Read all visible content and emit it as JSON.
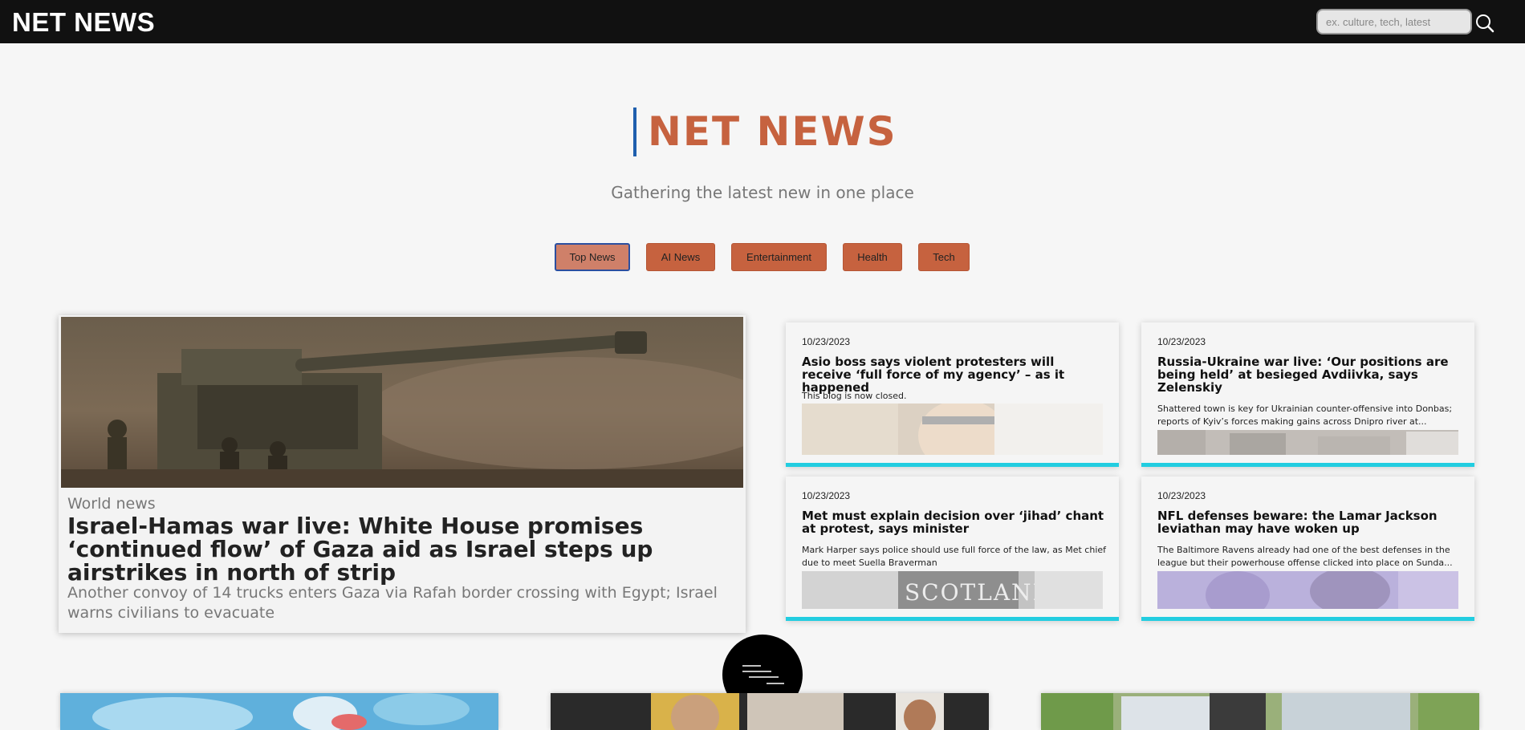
{
  "app": {
    "logo": "NET NEWS",
    "search_placeholder": "ex. culture, tech, latest"
  },
  "hero": {
    "title": "NET NEWS",
    "subtitle": "Gathering the latest new in one place"
  },
  "categories": [
    {
      "label": "Top News",
      "active": true
    },
    {
      "label": "AI News",
      "active": false
    },
    {
      "label": "Entertainment",
      "active": false
    },
    {
      "label": "Health",
      "active": false
    },
    {
      "label": "Tech",
      "active": false
    }
  ],
  "featured": {
    "section": "World news",
    "title": "Israel-Hamas war live: White House promises ‘continued flow’ of Gaza aid as Israel steps up airstrikes in north of strip",
    "description": "Another convoy of 14 trucks enters Gaza via Rafah border crossing with Egypt; Israel warns civilians to evacuate"
  },
  "cards": [
    {
      "date": "10/23/2023",
      "title": "Asio boss says violent protesters will receive ‘full force of my agency’ – as it happened",
      "description": "This blog is now closed."
    },
    {
      "date": "10/23/2023",
      "title": "Russia-Ukraine war live: ‘Our positions are being held’ at besieged Avdiivka, says Zelenskiy",
      "description": "Shattered town is key for Ukrainian counter-offensive into Donbas; reports of Kyiv’s forces making gains across Dnipro river at..."
    },
    {
      "date": "10/23/2023",
      "title": "Met must explain decision over ‘jihad’ chant at protest, says minister",
      "description": "Mark Harper says police should use full force of the law, as Met chief due to meet Suella Braverman",
      "image_text": "SCOTLAND"
    },
    {
      "date": "10/23/2023",
      "title": "NFL defenses beware: the Lamar Jackson leviathan may have woken up",
      "description": "The Baltimore Ravens already had one of the best defenses in the league but their powerhouse offense clicked into place on Sunda..."
    }
  ],
  "colors": {
    "accent": "#c6623f",
    "card_border": "#22cde0",
    "topbar": "#111111",
    "hero_bar": "#1f5fae"
  }
}
